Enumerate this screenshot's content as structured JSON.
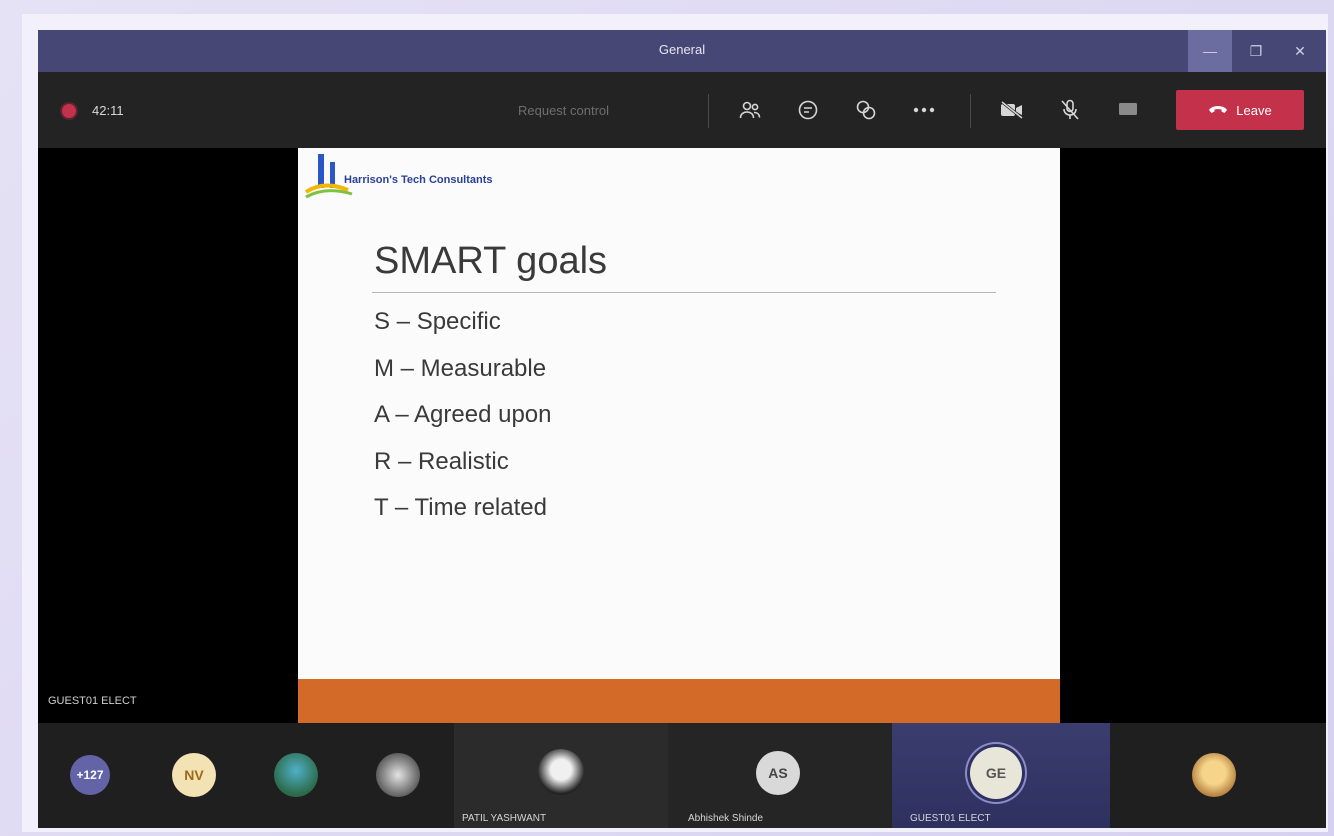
{
  "window": {
    "title": "General",
    "controls": {
      "minimize": "—",
      "maximize": "❐",
      "close": "✕"
    }
  },
  "toolbar": {
    "timer": "42:11",
    "request_control": "Request control",
    "leave_label": "Leave",
    "colors": {
      "leave": "#c4314b",
      "recording": "#c4314b"
    }
  },
  "slide": {
    "company": "Harrison's Tech Consultants",
    "title": "SMART goals",
    "items": [
      "S – Specific",
      "M – Measurable",
      "A – Agreed upon",
      "R – Realistic",
      "T – Time related"
    ],
    "band_color": "#d46a28"
  },
  "presenter": {
    "name": "GUEST01 ELECT"
  },
  "participants": {
    "overflow": "+127",
    "nv": "NV",
    "tile1_name": "PATIL YASHWANT",
    "as": "AS",
    "tile2_name": "Abhishek Shinde",
    "ge": "GE",
    "tile3_name": "GUEST01 ELECT"
  }
}
